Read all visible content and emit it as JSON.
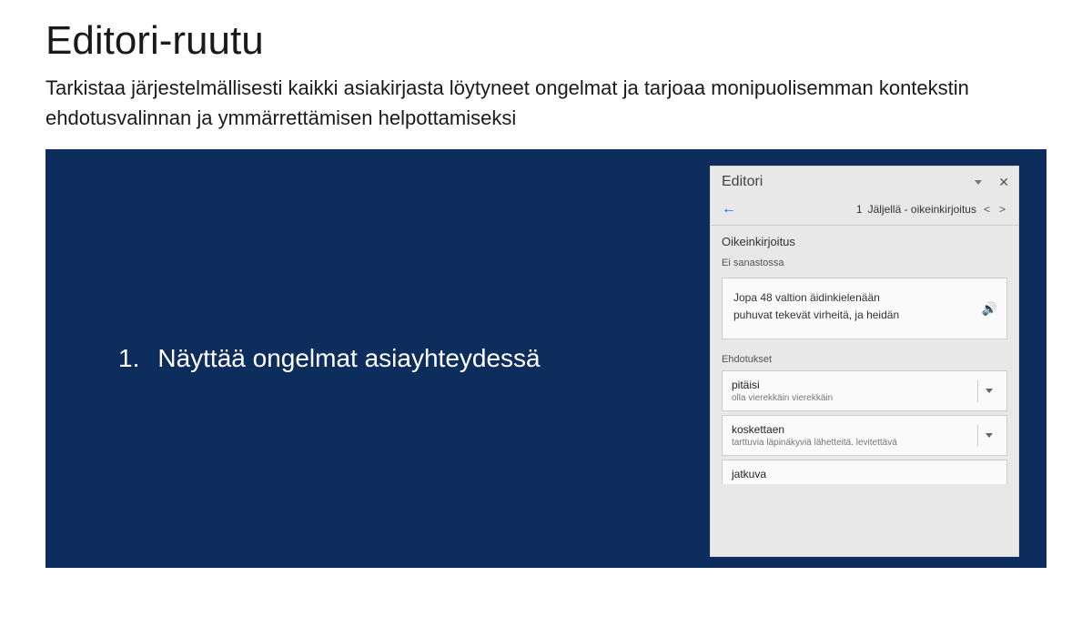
{
  "title": "Editori-ruutu",
  "subtitle": "Tarkistaa järjestelmällisesti kaikki asiakirjasta löytyneet ongelmat ja tarjoaa monipuolisemman kontekstin ehdotusvalinnan ja ymmärrettämisen helpottamiseksi",
  "hero": {
    "num": "1.",
    "text": "Näyttää ongelmat asiayhteydessä"
  },
  "panel": {
    "title": "Editori",
    "nav_count": "1",
    "nav_label": "Jäljellä - oikeinkirjoitus",
    "section": "Oikeinkirjoitus",
    "not_in_dict": "Ei sanastossa",
    "context_line1": "Jopa 48 valtion äidinkielenään",
    "context_line2": "puhuvat tekevät virheitä, ja heidän",
    "suggestions_label": "Ehdotukset",
    "suggestions": [
      {
        "main": "pitäisi",
        "sub": "olla vierekkäin vierekkäin"
      },
      {
        "main": "koskettaen",
        "sub": "tarttuvia läpinäkyviä lähetteitä. levitettävä"
      },
      {
        "main": "jatkuva",
        "sub": ""
      }
    ]
  }
}
